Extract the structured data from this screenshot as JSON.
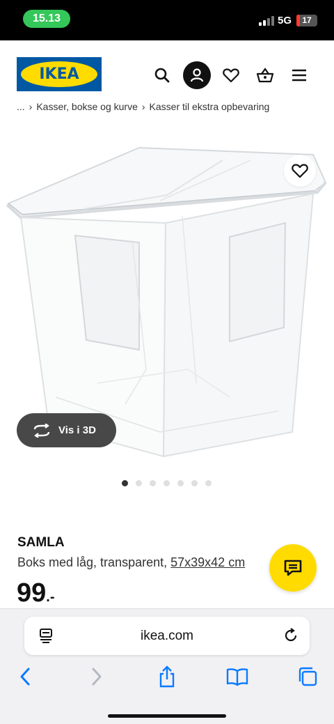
{
  "status_bar": {
    "time": "15.13",
    "network": "5G",
    "battery": "17",
    "battery_level": 0.17
  },
  "header": {
    "logo_text": "IKEA",
    "icons": [
      "search-icon",
      "profile-icon",
      "heart-icon",
      "basket-icon",
      "menu-icon"
    ]
  },
  "breadcrumb": {
    "items": [
      "...",
      "Kasser, bokse og kurve",
      "Kasser til ekstra opbevaring"
    ]
  },
  "gallery": {
    "view_3d_label": "Vis i 3D",
    "total_images": 7,
    "active_index": 0
  },
  "product": {
    "name": "SAMLA",
    "description": "Boks med låg, transparent, ",
    "measurement": "57x39x42 cm",
    "price": "99",
    "price_suffix": ".-"
  },
  "browser": {
    "url": "ikea.com"
  },
  "colors": {
    "ikea_blue": "#0058a3",
    "ikea_yellow": "#ffdb00",
    "ios_blue": "#0a7aff",
    "time_pill": "#34c759",
    "battery_red": "#ff3b30"
  }
}
